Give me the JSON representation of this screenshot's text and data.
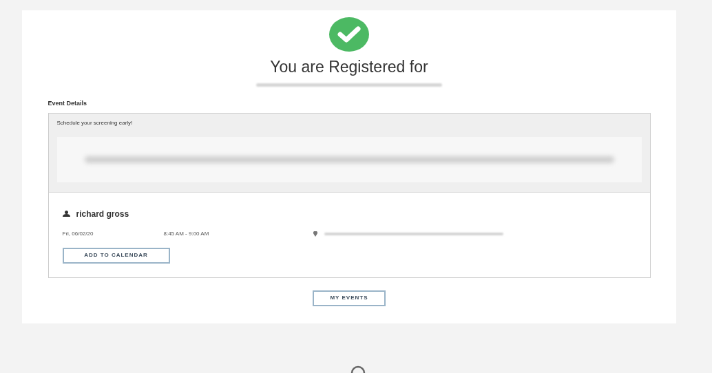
{
  "confirmation": {
    "title": "You are Registered for"
  },
  "event_details": {
    "heading": "Event Details",
    "banner_text": "Schedule your screening early!"
  },
  "appointment": {
    "name": "richard gross",
    "date": "Fri, 06/02/20",
    "time": "8:45 AM - 9:00 AM",
    "calendar_button": "ADD TO CALENDAR"
  },
  "my_events_button": "MY EVENTS"
}
